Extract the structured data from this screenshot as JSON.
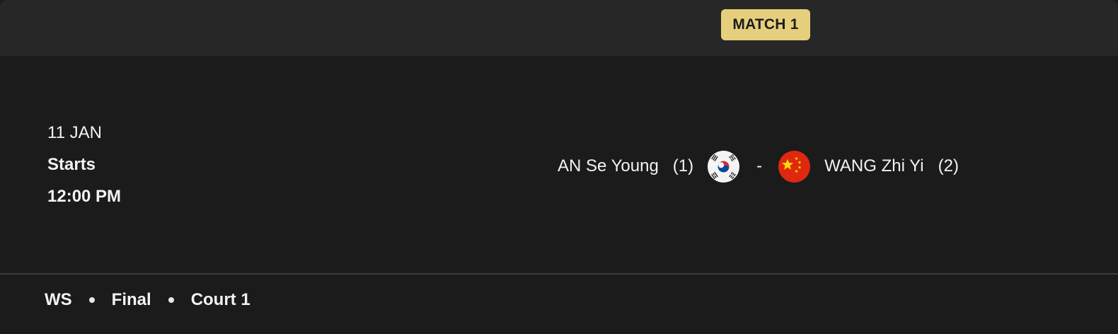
{
  "header": {
    "badge": "MATCH 1"
  },
  "schedule": {
    "date": "11 JAN",
    "starts_label": "Starts",
    "time": "12:00 PM"
  },
  "matchup": {
    "player1": {
      "name": "AN Se Young",
      "seed": "(1)",
      "flag_icon": "south-korea-flag-icon"
    },
    "separator": "-",
    "player2": {
      "name": "WANG Zhi Yi",
      "seed": "(2)",
      "flag_icon": "china-flag-icon"
    }
  },
  "footer": {
    "event": "WS",
    "round": "Final",
    "court": "Court 1"
  },
  "colors": {
    "background": "#1b1b1b",
    "header_background": "#272727",
    "badge_background": "#e6cf7c",
    "text": "#f2f2f2",
    "china_red": "#de2910",
    "china_yellow": "#ffde00",
    "korea_red": "#cd2e3a",
    "korea_blue": "#0047a0"
  }
}
